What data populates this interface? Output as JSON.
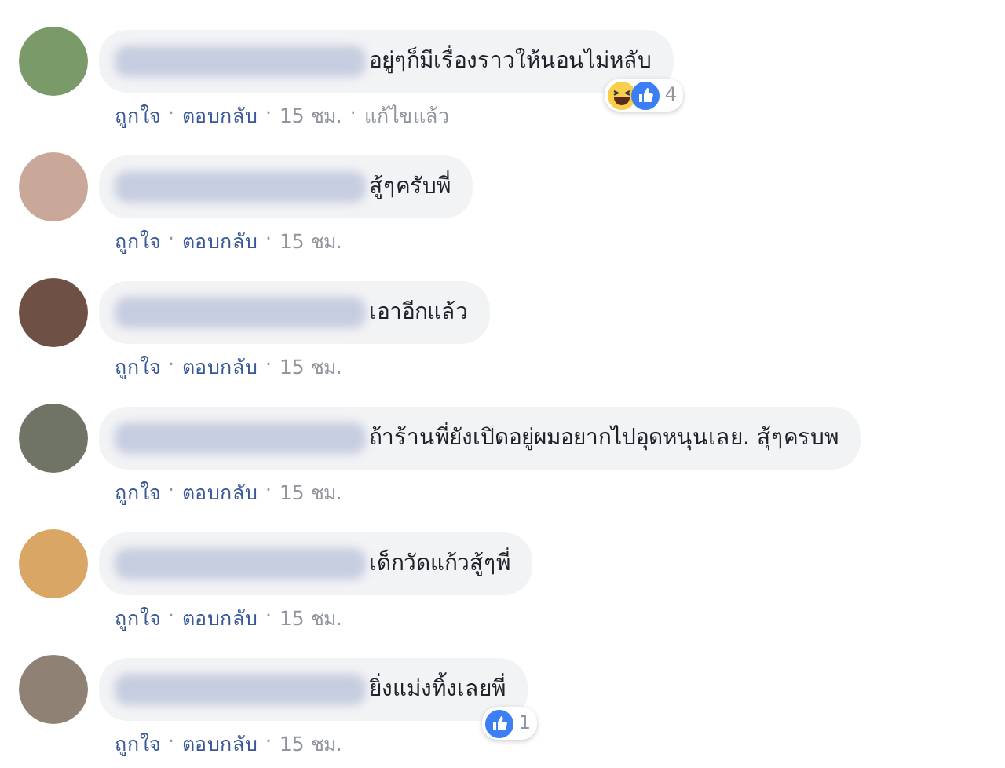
{
  "comments": [
    {
      "color": "#7a9a6a",
      "text": "อยู่ๆก็มีเรื่องราวให้นอนไม่หลับ",
      "actions": [
        {
          "kind": "link",
          "text": "ถูกใจ"
        },
        {
          "kind": "dot",
          "text": "·"
        },
        {
          "kind": "link",
          "text": "ตอบกลับ"
        },
        {
          "kind": "dot",
          "text": "·"
        },
        {
          "kind": "time",
          "text": "15 ชม."
        },
        {
          "kind": "dot",
          "text": "·"
        },
        {
          "kind": "edited",
          "text": "แก้ไขแล้ว"
        }
      ],
      "reactions": {
        "icons": [
          {
            "kind": "haha"
          },
          {
            "kind": "like"
          }
        ],
        "count": "4"
      }
    },
    {
      "color": "#c9a89a",
      "text": "สู้ๆครับพี่",
      "actions": [
        {
          "kind": "link",
          "text": "ถูกใจ"
        },
        {
          "kind": "dot",
          "text": "·"
        },
        {
          "kind": "link",
          "text": "ตอบกลับ"
        },
        {
          "kind": "dot",
          "text": "·"
        },
        {
          "kind": "time",
          "text": "15 ชม."
        }
      ]
    },
    {
      "color": "#6e5044",
      "text": "เอาอีกแล้ว",
      "actions": [
        {
          "kind": "link",
          "text": "ถูกใจ"
        },
        {
          "kind": "dot",
          "text": "·"
        },
        {
          "kind": "link",
          "text": "ตอบกลับ"
        },
        {
          "kind": "dot",
          "text": "·"
        },
        {
          "kind": "time",
          "text": "15 ชม."
        }
      ]
    },
    {
      "color": "#6f7466",
      "text": "ถ้าร้านพี่ยังเปิดอยู่ผมอยากไปอุดหนุนเลย. สุ้ๆครบพ",
      "actions": [
        {
          "kind": "link",
          "text": "ถูกใจ"
        },
        {
          "kind": "dot",
          "text": "·"
        },
        {
          "kind": "link",
          "text": "ตอบกลับ"
        },
        {
          "kind": "dot",
          "text": "·"
        },
        {
          "kind": "time",
          "text": "15 ชม."
        }
      ]
    },
    {
      "color": "#d9a665",
      "text": "เด็กวัดแก้วสู้ๆพี่",
      "actions": [
        {
          "kind": "link",
          "text": "ถูกใจ"
        },
        {
          "kind": "dot",
          "text": "·"
        },
        {
          "kind": "link",
          "text": "ตอบกลับ"
        },
        {
          "kind": "dot",
          "text": "·"
        },
        {
          "kind": "time",
          "text": "15 ชม."
        }
      ]
    },
    {
      "color": "#8f8174",
      "text": "ยิ่งแม่งทิ้งเลยพี่",
      "actions": [
        {
          "kind": "link",
          "text": "ถูกใจ"
        },
        {
          "kind": "dot",
          "text": "·"
        },
        {
          "kind": "link",
          "text": "ตอบกลับ"
        },
        {
          "kind": "dot",
          "text": "·"
        },
        {
          "kind": "time",
          "text": "15 ชม."
        }
      ],
      "reactions": {
        "icons": [
          {
            "kind": "like"
          }
        ],
        "count": "1"
      }
    }
  ]
}
